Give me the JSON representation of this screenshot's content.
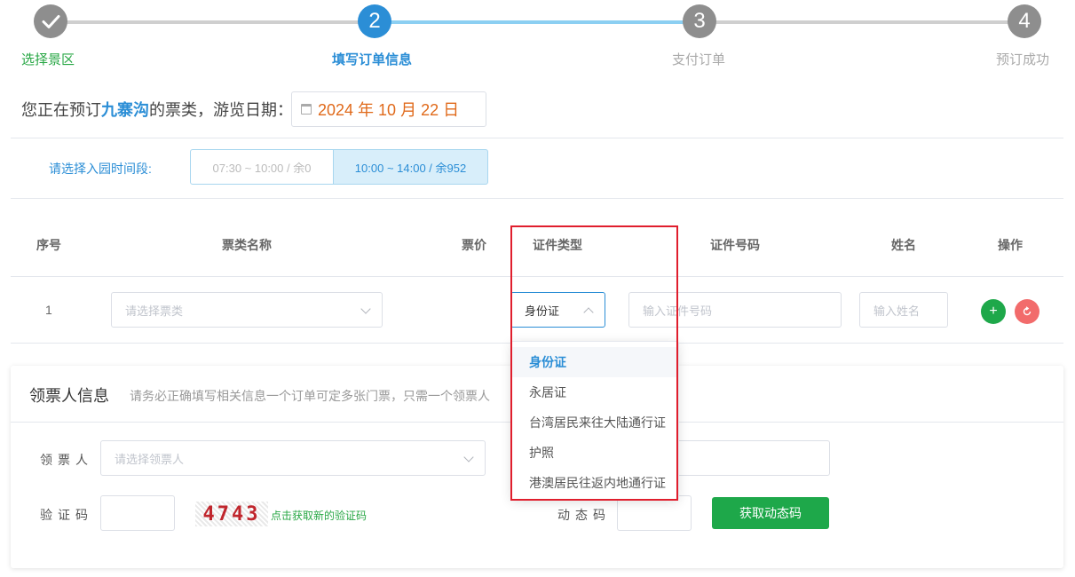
{
  "steps": [
    {
      "number": "",
      "label": "选择景区",
      "state": "done"
    },
    {
      "number": "2",
      "label": "填写订单信息",
      "state": "active"
    },
    {
      "number": "3",
      "label": "支付订单",
      "state": "pending"
    },
    {
      "number": "4",
      "label": "预订成功",
      "state": "pending"
    }
  ],
  "booking": {
    "prefix": "您正在预订",
    "scenic_name": "九寨沟",
    "suffix": "的票类，游览日期：",
    "date": "2024 年 10 月 22 日"
  },
  "time_slot": {
    "label": "请选择入园时间段:",
    "options": [
      {
        "text": "07:30 ~ 10:00 / 余0",
        "selected": false
      },
      {
        "text": "10:00 ~ 14:00 / 余952",
        "selected": true
      }
    ]
  },
  "table": {
    "headers": [
      "序号",
      "票类名称",
      "票价",
      "证件类型",
      "证件号码",
      "姓名",
      "操作"
    ],
    "rows": [
      {
        "index": "1",
        "ticket_placeholder": "请选择票类",
        "id_type": "身份证",
        "id_number_placeholder": "输入证件号码",
        "name_placeholder": "输入姓名"
      }
    ]
  },
  "id_type_dropdown": {
    "options": [
      "身份证",
      "永居证",
      "台湾居民来往大陆通行证",
      "护照",
      "港澳居民往返内地通行证"
    ],
    "selected": "身份证"
  },
  "receiver": {
    "title": "领票人信息",
    "hint": "请务必正确填写相关信息一个订单可定多张门票，只需一个领票人",
    "receiver_label": "领票人",
    "receiver_placeholder": "请选择领票人",
    "captcha_label": "验证码",
    "captcha_text": "4743",
    "captcha_refresh": "点击获取新的验证码",
    "dynamic_code_label": "动态码",
    "get_code_button": "获取动态码"
  },
  "colors": {
    "done": "#8e8e8e",
    "active": "#2b8ed6",
    "pending": "#8e8e8e",
    "add": "#1ea84a",
    "remove": "#f26b6b",
    "highlight": "#e01e2d"
  },
  "icons": [
    "check-icon",
    "calendar-icon",
    "chevron-down-icon",
    "chevron-up-icon",
    "plus-icon",
    "refresh-icon"
  ]
}
